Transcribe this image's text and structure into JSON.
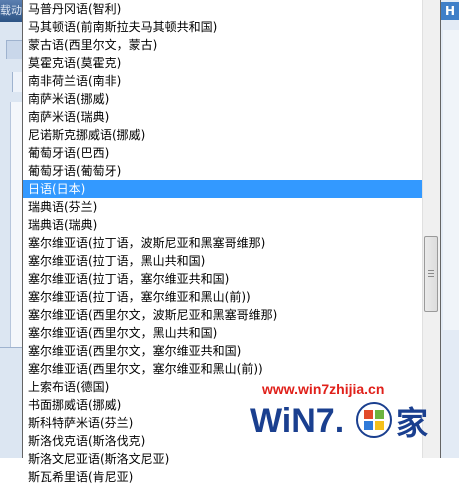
{
  "background": {
    "title_fragment": "载动",
    "close_glyph": "H"
  },
  "dropdown": {
    "selected_index": 9,
    "items": [
      "马普丹冈语(智利)",
      "马其顿语(前南斯拉夫马其顿共和国)",
      "蒙古语(西里尔文，蒙古)",
      "莫霍克语(莫霍克)",
      "南非荷兰语(南非)",
      "南萨米语(挪威)",
      "南萨米语(瑞典)",
      "尼诺斯克挪威语(挪威)",
      "葡萄牙语(巴西)",
      "葡萄牙语(葡萄牙)",
      "日语(日本)",
      "瑞典语(芬兰)",
      "瑞典语(瑞典)",
      "塞尔维亚语(拉丁语，波斯尼亚和黑塞哥维那)",
      "塞尔维亚语(拉丁语，黑山共和国)",
      "塞尔维亚语(拉丁语，塞尔维亚共和国)",
      "塞尔维亚语(拉丁语，塞尔维亚和黑山(前))",
      "塞尔维亚语(西里尔文，波斯尼亚和黑塞哥维那)",
      "塞尔维亚语(西里尔文，黑山共和国)",
      "塞尔维亚语(西里尔文，塞尔维亚共和国)",
      "塞尔维亚语(西里尔文，塞尔维亚和黑山(前))",
      "上索布语(德国)",
      "书面挪威语(挪威)",
      "斯科特萨米语(芬兰)",
      "斯洛伐克语(斯洛伐克)",
      "斯洛文尼亚语(斯洛文尼亚)",
      "斯瓦希里语(肯尼亚)"
    ]
  },
  "watermark": {
    "url": "www.win7zhijia.cn",
    "logo_text": "WiN7.",
    "logo_suffix": "家"
  },
  "colors": {
    "selection": "#3399ff",
    "watermark_red": "#e0201a"
  }
}
